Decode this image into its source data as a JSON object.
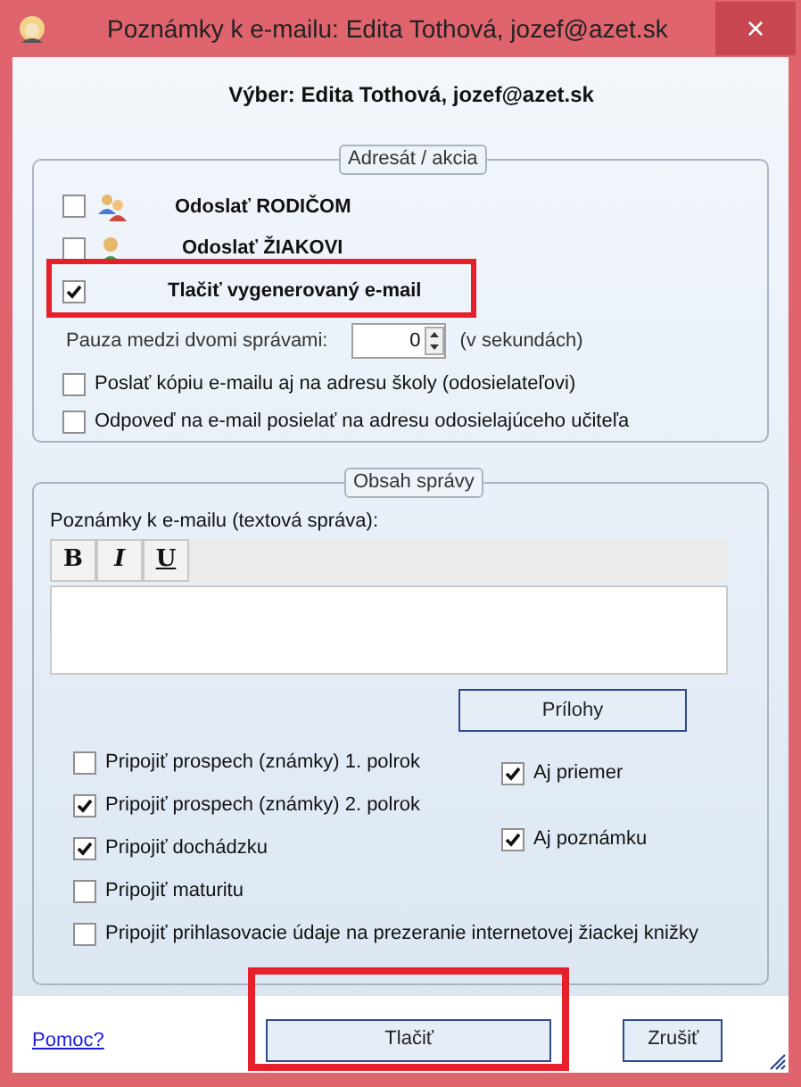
{
  "window": {
    "title": "Poznámky k e-mailu: Edita Tothová, jozef@azet.sk",
    "close": "×"
  },
  "selection": "Výber: Edita Tothová, jozef@azet.sk",
  "recipient_group": {
    "legend": "Adresát / akcia",
    "actions": [
      {
        "kind": "parents",
        "label": "Odoslať RODIČOM",
        "checked": false,
        "highlighted": false
      },
      {
        "kind": "student",
        "label": "Odoslať ŽIAKOVI",
        "checked": false,
        "highlighted": false
      },
      {
        "kind": "print",
        "label": "Tlačiť vygenerovaný e-mail",
        "checked": true,
        "highlighted": true
      }
    ],
    "pause": {
      "label": "Pauza medzi dvomi správami:",
      "value": "0",
      "unit": "(v sekundách)"
    },
    "options": [
      {
        "label": "Poslať kópiu e-mailu aj na adresu školy (odosielateľovi)",
        "checked": false
      },
      {
        "label": "Odpoveď na e-mail posielať na adresu odosielajúceho učiteľa",
        "checked": false
      }
    ]
  },
  "content_group": {
    "legend": "Obsah správy",
    "notes_label": "Poznámky k e-mailu (textová správa):",
    "format_buttons": [
      {
        "kind": "bold",
        "label": "B"
      },
      {
        "kind": "italic",
        "label": "I"
      },
      {
        "kind": "underline",
        "label": "U"
      }
    ],
    "attachments_button": "Prílohy",
    "attach_options": [
      {
        "label": "Pripojiť prospech (známky) 1. polrok",
        "checked": false
      },
      {
        "label": "Pripojiť prospech (známky) 2. polrok",
        "checked": true
      },
      {
        "label": "Pripojiť dochádzku",
        "checked": true
      },
      {
        "label": "Pripojiť maturitu",
        "checked": false
      },
      {
        "label": "Pripojiť prihlasovacie údaje na prezeranie internetovej žiackej knižky",
        "checked": false
      }
    ],
    "extra_options": [
      {
        "label": "Aj priemer",
        "checked": true
      },
      {
        "label": "Aj poznámku",
        "checked": true
      }
    ]
  },
  "footer": {
    "help_link": "Pomoc?",
    "print_button": {
      "label": "Tlačiť",
      "highlighted": true
    },
    "cancel_button": "Zrušiť"
  }
}
